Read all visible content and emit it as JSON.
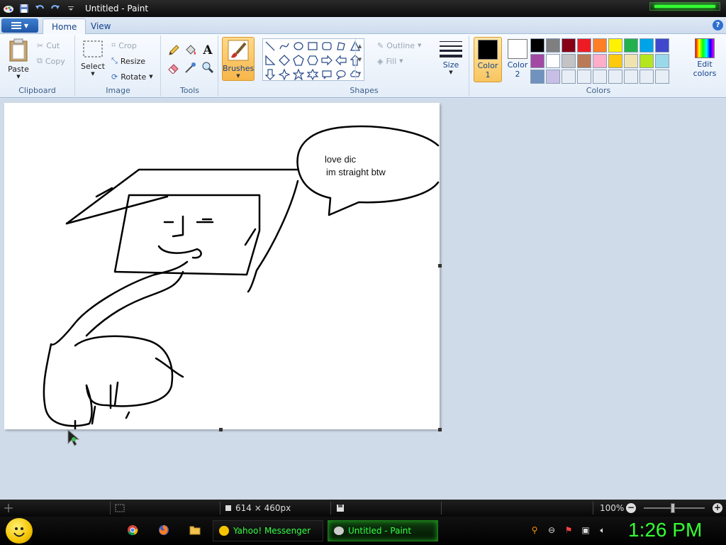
{
  "window": {
    "title": "Untitled - Paint",
    "qa_icons": [
      "save-icon",
      "undo-icon",
      "redo-icon",
      "customize-icon"
    ]
  },
  "tabs": [
    {
      "label": "Home",
      "active": true
    },
    {
      "label": "View",
      "active": false
    }
  ],
  "help_label": "?",
  "clipboard": {
    "group": "Clipboard",
    "paste": "Paste",
    "cut": "Cut",
    "copy": "Copy"
  },
  "image": {
    "group": "Image",
    "select": "Select",
    "crop": "Crop",
    "resize": "Resize",
    "rotate": "Rotate"
  },
  "tools": {
    "group": "Tools",
    "items": [
      "pencil-icon",
      "fill-icon",
      "text-icon",
      "eraser-icon",
      "color-picker-icon",
      "magnifier-icon"
    ]
  },
  "brushes": {
    "label": "Brushes"
  },
  "shapes": {
    "group": "Shapes",
    "outline": "Outline",
    "fill": "Fill"
  },
  "size": {
    "label": "Size"
  },
  "colors": {
    "group": "Colors",
    "color1_label": "Color",
    "color1_num": "1",
    "color2_label": "Color",
    "color2_num": "2",
    "edit_label": "Edit",
    "edit_label2": "colors",
    "color1": "#000000",
    "color2": "#ffffff",
    "palette": [
      "#000000",
      "#7f7f7f",
      "#880015",
      "#ed1c24",
      "#ff7f27",
      "#fff200",
      "#22b14c",
      "#00a2e8",
      "#3f48cc",
      "#a349a4",
      "#ffffff",
      "#c3c3c3",
      "#b97a57",
      "#ffaec9",
      "#ffc90e",
      "#efe4b0",
      "#b5e61d",
      "#99d9ea",
      "#7092be",
      "#c8bfe7"
    ]
  },
  "canvas": {
    "bubble_line1": "love dic",
    "bubble_line2": "im straight btw"
  },
  "status": {
    "canvas_size": "614 × 460px",
    "zoom": "100%"
  },
  "taskbar": {
    "buttons": [
      {
        "label": "Yahoo! Messenger",
        "active": false
      },
      {
        "label": "Untitled - Paint",
        "active": true
      }
    ],
    "clock": "1:26 PM"
  }
}
